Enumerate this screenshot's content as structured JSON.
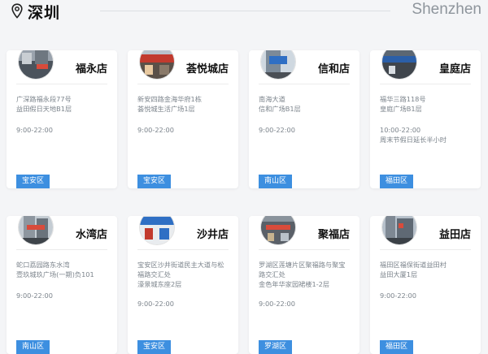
{
  "header": {
    "city_cn": "深圳",
    "city_en": "Shenzhen"
  },
  "colors": {
    "accent": "#3d8fe0",
    "muted_text": "#7c848c",
    "background": "#f4f5f7"
  },
  "stores": [
    {
      "name": "福永店",
      "address": "广深路福永段77号\n益田假日天地B1层",
      "hours": "9:00-22:00",
      "district": "宝安区"
    },
    {
      "name": "荟悦城店",
      "address": "新安四路金海华府1栋\n荟悦城生活广场1层",
      "hours": "9:00-22:00",
      "district": "宝安区"
    },
    {
      "name": "信和店",
      "address": "南海大道\n信和广场B1层",
      "hours": "9:00-22:00",
      "district": "南山区"
    },
    {
      "name": "皇庭店",
      "address": "福华三路118号\n皇庭广场B1层",
      "hours": "10:00-22:00\n周末节假日延长半小时",
      "district": "福田区"
    },
    {
      "name": "水湾店",
      "address": "蛇口荔园路东水湾\n壹玖城玖广场(一期)负101",
      "hours": "9:00-22:00",
      "district": "南山区"
    },
    {
      "name": "沙井店",
      "address": "宝安区沙井街道民主大道与松\n福路交汇处\n濠景城东座2层",
      "hours": "9:00-22:00",
      "district": "宝安区"
    },
    {
      "name": "聚福店",
      "address": "罗湖区莲塘片区聚福路与聚宝\n路交汇处\n金色年华家园裙楼1-2层",
      "hours": "9:00-22:00",
      "district": "罗湖区"
    },
    {
      "name": "益田店",
      "address": "福田区福保街道益田村\n益田大厦1层",
      "hours": "9:00-22:00",
      "district": "福田区"
    }
  ]
}
